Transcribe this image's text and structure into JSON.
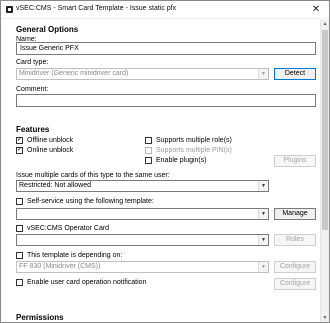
{
  "window": {
    "title": "vSEC:CMS - Smart Card Template - Issue static pfx",
    "close_glyph": "✕"
  },
  "general": {
    "heading": "General Options",
    "name_label": "Name:",
    "name_value": "Issue Generic PFX",
    "card_type_label": "Card type:",
    "card_type_value": "Minidriver (Generic minidriver card)",
    "detect_label": "Detect",
    "comment_label": "Comment:",
    "comment_value": ""
  },
  "features": {
    "heading": "Features",
    "offline_unblock": {
      "label": "Offline unblock",
      "checked": true
    },
    "online_unblock": {
      "label": "Online unblock",
      "checked": true
    },
    "multiple_roles": {
      "label": "Supports multiple role(s)",
      "checked": false
    },
    "multiple_pins": {
      "label": "Supports multiple PIN(s)",
      "checked": false
    },
    "enable_plugins": {
      "label": "Enable plugin(s)",
      "checked": false
    },
    "plugins_label": "Plugins",
    "issue_multiple_label": "Issue multiple cards of this type to the same user:",
    "issue_multiple_value": "Restricted: Not allowed",
    "self_service": {
      "label": "Self-service using the following template:",
      "checked": false
    },
    "self_service_value": "",
    "manage_label": "Manage",
    "operator_card": {
      "label": "vSEC:CMS Operator Card",
      "checked": false
    },
    "operator_value": "",
    "roles_label": "Roles",
    "depending_on": {
      "label": "This template is depending on:",
      "checked": false
    },
    "depending_value": "FF 830 (Minidriver (CMS))",
    "configure_label_1": "Configure",
    "notification": {
      "label": "Enable user card operation notification",
      "checked": false
    },
    "configure_label_2": "Configure"
  },
  "permissions": {
    "heading": "Permissions"
  },
  "scrollbar": {
    "up": "▲",
    "down": "▼"
  },
  "icons": {
    "check_glyph": "✓",
    "dropdown_glyph": "▼"
  }
}
